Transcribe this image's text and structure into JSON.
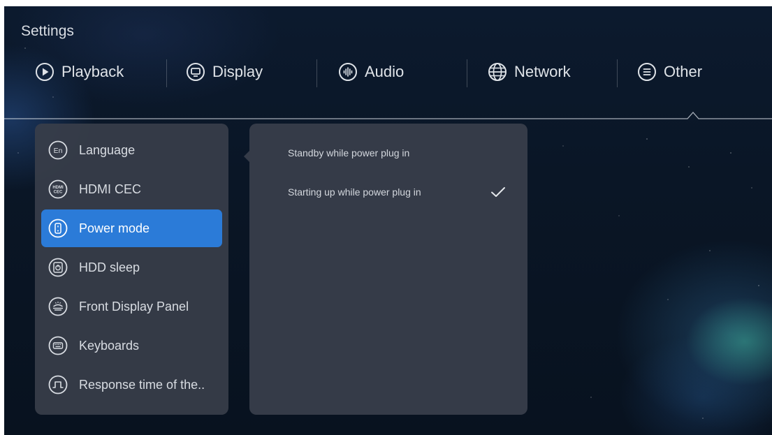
{
  "header": {
    "title": "Settings"
  },
  "tabs": [
    {
      "label": "Playback",
      "icon": "play-circle-icon"
    },
    {
      "label": "Display",
      "icon": "monitor-icon"
    },
    {
      "label": "Audio",
      "icon": "audio-wave-icon"
    },
    {
      "label": "Network",
      "icon": "globe-icon"
    },
    {
      "label": "Other",
      "icon": "menu-lines-icon"
    }
  ],
  "active_tab": "Other",
  "sidebar": {
    "items": [
      {
        "label": "Language",
        "icon": "language-en-icon"
      },
      {
        "label": "HDMI CEC",
        "icon": "hdmi-cec-icon"
      },
      {
        "label": "Power mode",
        "icon": "power-mode-icon"
      },
      {
        "label": "HDD sleep",
        "icon": "hdd-sleep-icon"
      },
      {
        "label": "Front Display Panel",
        "icon": "front-display-icon"
      },
      {
        "label": "Keyboards",
        "icon": "keyboard-icon"
      },
      {
        "label": "Response time of the..",
        "icon": "pulse-wave-icon"
      }
    ],
    "selected": "Power mode"
  },
  "options": {
    "items": [
      {
        "label": "Standby while power plug in",
        "checked": false
      },
      {
        "label": "Starting up while power plug in",
        "checked": true
      }
    ]
  },
  "colors": {
    "accent": "#2b7bd8",
    "panel": "#383e4a",
    "background": "#0a1626"
  }
}
